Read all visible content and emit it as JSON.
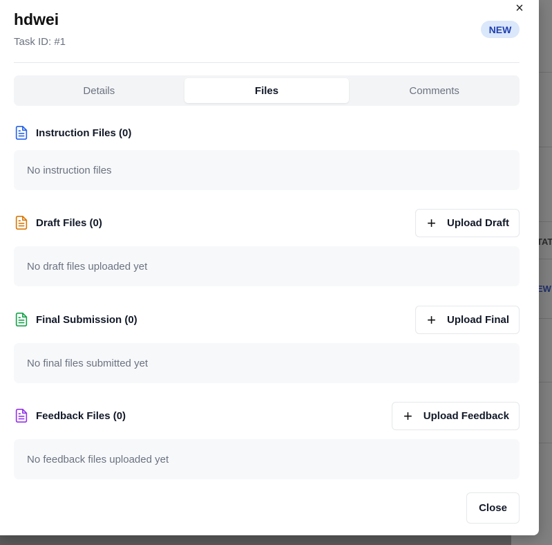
{
  "background": {
    "texts": [
      "TAT",
      "EW"
    ]
  },
  "dialog": {
    "title": "hdwei",
    "subtitle": "Task ID: #1",
    "badge": "NEW",
    "close_icon": "close-icon",
    "close_glyph": "×",
    "close_button": "Close"
  },
  "tabs": [
    {
      "label": "Details",
      "active": false
    },
    {
      "label": "Files",
      "active": true
    },
    {
      "label": "Comments",
      "active": false
    }
  ],
  "sections": [
    {
      "label": "Instruction Files (0)",
      "icon": "document-icon",
      "color": "#2563eb",
      "empty": "No instruction files"
    },
    {
      "label": "Draft Files (0)",
      "icon": "document-icon",
      "color": "#d97706",
      "empty": "No draft files uploaded yet",
      "button": "Upload Draft"
    },
    {
      "label": "Final Submission (0)",
      "icon": "document-icon",
      "color": "#16a34a",
      "empty": "No final files submitted yet",
      "button": "Upload Final"
    },
    {
      "label": "Feedback Files (0)",
      "icon": "document-icon",
      "color": "#9333ea",
      "empty": "No feedback files uploaded yet",
      "button": "Upload Feedback"
    }
  ],
  "plus_glyph": "+"
}
